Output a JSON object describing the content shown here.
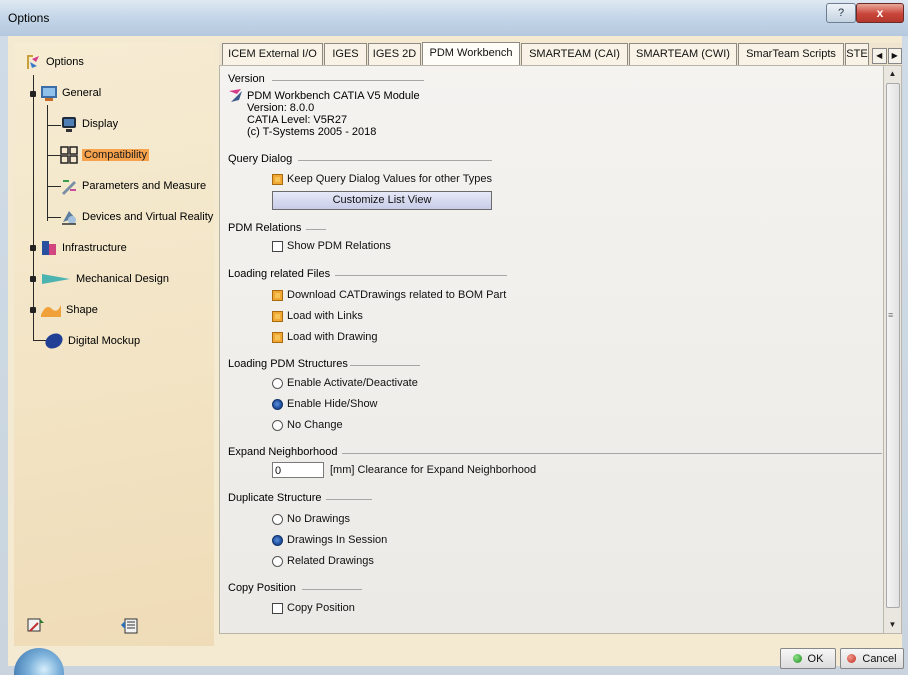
{
  "window": {
    "title": "Options",
    "help_label": "?",
    "close_label": "x"
  },
  "tree": {
    "root": {
      "label": "Options",
      "icon": "options-icon"
    },
    "items": [
      {
        "label": "General",
        "icon": "general-icon"
      },
      {
        "label": "Display",
        "icon": "display-icon"
      },
      {
        "label": "Compatibility",
        "icon": "compatibility-icon",
        "selected": true
      },
      {
        "label": "Parameters and Measure",
        "icon": "parameters-icon"
      },
      {
        "label": "Devices and Virtual Reality",
        "icon": "devices-icon"
      },
      {
        "label": "Infrastructure",
        "icon": "infrastructure-icon"
      },
      {
        "label": "Mechanical Design",
        "icon": "mechanical-design-icon"
      },
      {
        "label": "Shape",
        "icon": "shape-icon"
      },
      {
        "label": "Digital Mockup",
        "icon": "digital-mockup-icon"
      }
    ]
  },
  "tabs": [
    {
      "label": "ICEM External I/O"
    },
    {
      "label": "IGES"
    },
    {
      "label": "IGES 2D"
    },
    {
      "label": "PDM Workbench",
      "active": true
    },
    {
      "label": "SMARTEAM (CAI)"
    },
    {
      "label": "SMARTEAM (CWI)"
    },
    {
      "label": "SmarTeam Scripts"
    },
    {
      "label": "STE"
    }
  ],
  "version": {
    "title": "Version",
    "line1": "PDM Workbench CATIA V5 Module",
    "line2": "Version: 8.0.0",
    "line3": "CATIA Level: V5R27",
    "line4": "(c) T-Systems 2005 - 2018"
  },
  "query_dialog": {
    "title": "Query Dialog",
    "keep_values_label": "Keep Query Dialog Values for other Types",
    "keep_values_checked": true,
    "customize_button": "Customize List View"
  },
  "pdm_relations": {
    "title": "PDM Relations",
    "show_label": "Show PDM Relations",
    "show_checked": false
  },
  "loading_files": {
    "title": "Loading related Files",
    "options": [
      {
        "label": "Download CATDrawings related to BOM Part",
        "checked": true
      },
      {
        "label": "Load with Links",
        "checked": true
      },
      {
        "label": "Load with Drawing",
        "checked": true
      }
    ]
  },
  "loading_structures": {
    "title": "Loading PDM Structures",
    "options": [
      {
        "label": "Enable Activate/Deactivate",
        "selected": false
      },
      {
        "label": "Enable Hide/Show",
        "selected": true
      },
      {
        "label": "No Change",
        "selected": false
      }
    ]
  },
  "expand_neighborhood": {
    "title": "Expand Neighborhood",
    "value": "0",
    "label": "[mm]  Clearance for Expand Neighborhood"
  },
  "duplicate_structure": {
    "title": "Duplicate Structure",
    "options": [
      {
        "label": "No Drawings",
        "selected": false
      },
      {
        "label": "Drawings In Session",
        "selected": true
      },
      {
        "label": "Related Drawings",
        "selected": false
      }
    ]
  },
  "copy_position": {
    "title": "Copy Position",
    "label": "Copy Position",
    "checked": false
  },
  "buttons": {
    "ok": "OK",
    "cancel": "Cancel"
  }
}
